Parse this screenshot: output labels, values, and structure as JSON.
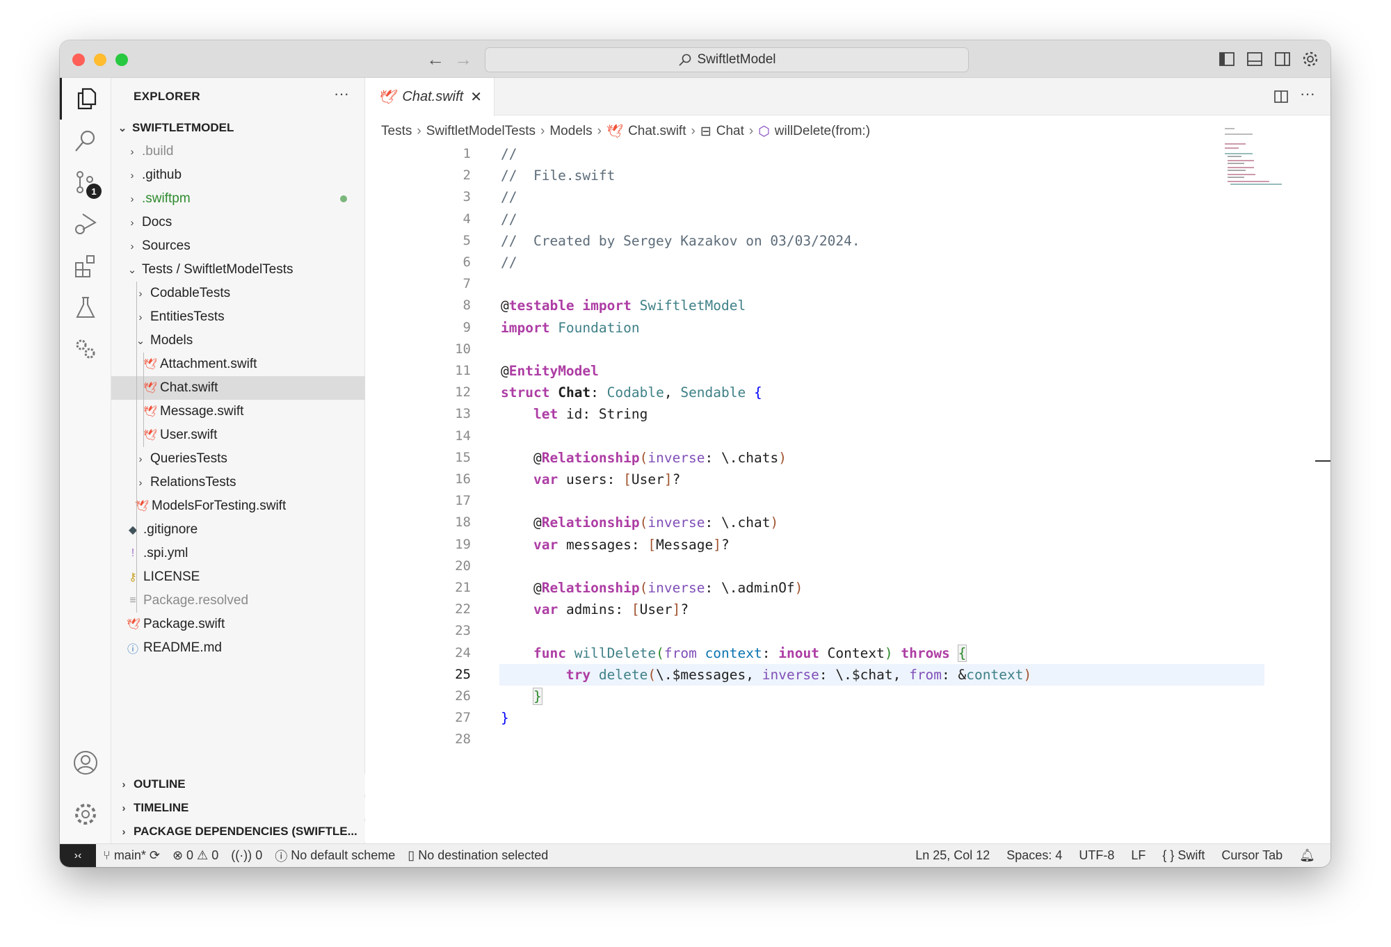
{
  "titlebar": {
    "search_text": "SwiftletModel",
    "traffic_colors": {
      "close": "#fe5f57",
      "minimize": "#febc2e",
      "zoom": "#28c840"
    }
  },
  "activity": {
    "scm_badge": "1",
    "items": [
      "files-icon",
      "search-icon",
      "source-control-icon",
      "run-debug-icon",
      "extensions-icon",
      "testing-icon",
      "swift-packages-icon"
    ],
    "bottom": [
      "account-icon",
      "settings-icon"
    ]
  },
  "sidebar": {
    "title": "EXPLORER",
    "more": "···",
    "root": "SWIFTLETMODEL",
    "items": [
      {
        "label": ".build",
        "depth": 0,
        "kind": "folder",
        "open": false,
        "color": "#8a8a8a"
      },
      {
        "label": ".github",
        "depth": 0,
        "kind": "folder",
        "open": false
      },
      {
        "label": ".swiftpm",
        "depth": 0,
        "kind": "folder",
        "open": false,
        "color": "#2e8b2e",
        "dot": true
      },
      {
        "label": "Docs",
        "depth": 0,
        "kind": "folder",
        "open": false
      },
      {
        "label": "Sources",
        "depth": 0,
        "kind": "folder",
        "open": false
      },
      {
        "label": "Tests / SwiftletModelTests",
        "depth": 0,
        "kind": "folder",
        "open": true
      },
      {
        "label": "CodableTests",
        "depth": 1,
        "kind": "folder",
        "open": false
      },
      {
        "label": "EntitiesTests",
        "depth": 1,
        "kind": "folder",
        "open": false
      },
      {
        "label": "Models",
        "depth": 1,
        "kind": "folder",
        "open": true
      },
      {
        "label": "Attachment.swift",
        "depth": 2,
        "kind": "swift"
      },
      {
        "label": "Chat.swift",
        "depth": 2,
        "kind": "swift",
        "selected": true
      },
      {
        "label": "Message.swift",
        "depth": 2,
        "kind": "swift"
      },
      {
        "label": "User.swift",
        "depth": 2,
        "kind": "swift"
      },
      {
        "label": "QueriesTests",
        "depth": 1,
        "kind": "folder",
        "open": false
      },
      {
        "label": "RelationsTests",
        "depth": 1,
        "kind": "folder",
        "open": false
      },
      {
        "label": "ModelsForTesting.swift",
        "depth": 1,
        "kind": "swift"
      },
      {
        "label": ".gitignore",
        "depth": 0,
        "kind": "git"
      },
      {
        "label": ".spi.yml",
        "depth": 0,
        "kind": "yml"
      },
      {
        "label": "LICENSE",
        "depth": 0,
        "kind": "license"
      },
      {
        "label": "Package.resolved",
        "depth": 0,
        "kind": "resolved",
        "color": "#8a8a8a"
      },
      {
        "label": "Package.swift",
        "depth": 0,
        "kind": "swift"
      },
      {
        "label": "README.md",
        "depth": 0,
        "kind": "info"
      }
    ],
    "sections": [
      "OUTLINE",
      "TIMELINE",
      "PACKAGE DEPENDENCIES (SWIFTLE..."
    ]
  },
  "editor": {
    "tab": "Chat.swift",
    "breadcrumbs": [
      "Tests",
      "SwiftletModelTests",
      "Models",
      "Chat.swift",
      "Chat",
      "willDelete(from:)"
    ],
    "current_line": 25,
    "lines": [
      [
        [
          "//",
          "com"
        ]
      ],
      [
        [
          "//  File.swift",
          "com"
        ]
      ],
      [
        [
          "//",
          "com"
        ]
      ],
      [
        [
          "//",
          "com"
        ]
      ],
      [
        [
          "//  Created by Sergey Kazakov on 03/03/2024.",
          "com"
        ]
      ],
      [
        [
          "//",
          "com"
        ]
      ],
      [],
      [
        [
          "@",
          ""
        ],
        [
          "testable",
          "attr"
        ],
        [
          " ",
          ""
        ],
        [
          "import",
          "kw"
        ],
        [
          " SwiftletModel",
          "type"
        ]
      ],
      [
        [
          "import",
          "kw"
        ],
        [
          " Foundation",
          "type"
        ]
      ],
      [],
      [
        [
          "@",
          ""
        ],
        [
          "EntityModel",
          "attr"
        ]
      ],
      [
        [
          "struct",
          "kw"
        ],
        [
          " ",
          ""
        ],
        [
          "Chat",
          "kwb"
        ],
        [
          ": ",
          ""
        ],
        [
          "Codable",
          "type"
        ],
        [
          ", ",
          ""
        ],
        [
          "Sendable",
          "type"
        ],
        [
          " ",
          ""
        ],
        [
          "{",
          "brace"
        ]
      ],
      [
        [
          "    ",
          ""
        ],
        [
          "let",
          "kw"
        ],
        [
          " id: String",
          ""
        ]
      ],
      [],
      [
        [
          "    @",
          ""
        ],
        [
          "Relationship",
          "attr"
        ],
        [
          "(",
          "br"
        ],
        [
          "inverse",
          "lbl"
        ],
        [
          ": \\.chats",
          ""
        ],
        [
          ")",
          "br"
        ]
      ],
      [
        [
          "    ",
          ""
        ],
        [
          "var",
          "kw"
        ],
        [
          " users: ",
          ""
        ],
        [
          "[",
          "br"
        ],
        [
          "User",
          ""
        ],
        [
          "]",
          "br"
        ],
        [
          "?",
          ""
        ]
      ],
      [],
      [
        [
          "    @",
          ""
        ],
        [
          "Relationship",
          "attr"
        ],
        [
          "(",
          "br"
        ],
        [
          "inverse",
          "lbl"
        ],
        [
          ": \\.chat",
          ""
        ],
        [
          ")",
          "br"
        ]
      ],
      [
        [
          "    ",
          ""
        ],
        [
          "var",
          "kw"
        ],
        [
          " messages: ",
          ""
        ],
        [
          "[",
          "br"
        ],
        [
          "Message",
          ""
        ],
        [
          "]",
          "br"
        ],
        [
          "?",
          ""
        ]
      ],
      [],
      [
        [
          "    @",
          ""
        ],
        [
          "Relationship",
          "attr"
        ],
        [
          "(",
          "br"
        ],
        [
          "inverse",
          "lbl"
        ],
        [
          ": \\.adminOf",
          ""
        ],
        [
          ")",
          "br"
        ]
      ],
      [
        [
          "    ",
          ""
        ],
        [
          "var",
          "kw"
        ],
        [
          " admins: ",
          ""
        ],
        [
          "[",
          "br"
        ],
        [
          "User",
          ""
        ],
        [
          "]",
          "br"
        ],
        [
          "?",
          ""
        ]
      ],
      [],
      [
        [
          "    ",
          ""
        ],
        [
          "func",
          "kw"
        ],
        [
          " ",
          ""
        ],
        [
          "willDelete",
          "fn"
        ],
        [
          "(",
          "brg"
        ],
        [
          "from",
          "lbl"
        ],
        [
          " ",
          ""
        ],
        [
          "context",
          "param"
        ],
        [
          ": ",
          ""
        ],
        [
          "inout",
          "kw"
        ],
        [
          " Context",
          ""
        ],
        [
          ")",
          "brg"
        ],
        [
          " ",
          ""
        ],
        [
          "throws",
          "kw"
        ],
        [
          " ",
          ""
        ],
        [
          "{",
          "brace2"
        ]
      ],
      [
        [
          "        ",
          ""
        ],
        [
          "try",
          "kw"
        ],
        [
          " ",
          ""
        ],
        [
          "delete",
          "fn"
        ],
        [
          "(",
          "br"
        ],
        [
          "\\.$messages, ",
          ""
        ],
        [
          "inverse",
          "lbl"
        ],
        [
          ": \\.$chat, ",
          ""
        ],
        [
          "from",
          "lbl"
        ],
        [
          ": &",
          ""
        ],
        [
          "context",
          "fn"
        ],
        [
          ")",
          "br"
        ]
      ],
      [
        [
          "    ",
          ""
        ],
        [
          "}",
          "brace2"
        ]
      ],
      [
        [
          "}",
          "brace"
        ]
      ],
      []
    ]
  },
  "status": {
    "branch": "main*",
    "errors": "0",
    "warnings": "0",
    "ports": "0",
    "scheme": "No default scheme",
    "destination": "No destination selected",
    "position": "Ln 25, Col 12",
    "spaces": "Spaces: 4",
    "encoding": "UTF-8",
    "eol": "LF",
    "language": "Swift",
    "cursor": "Cursor Tab"
  }
}
